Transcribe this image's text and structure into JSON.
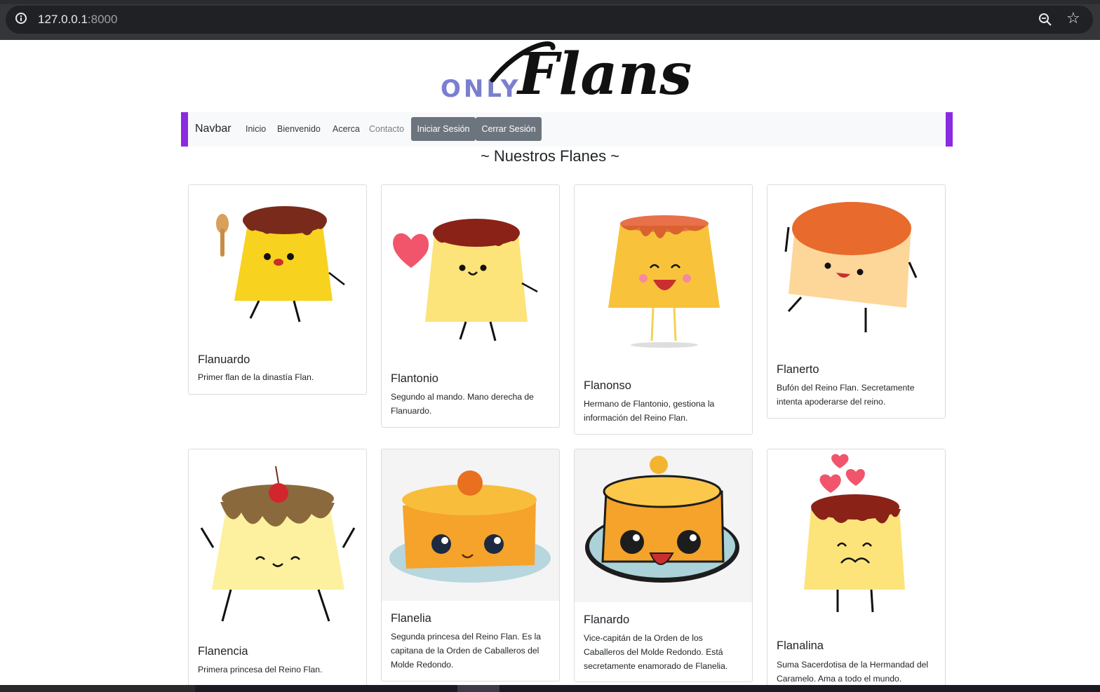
{
  "browser": {
    "url_host": "127.0.0.1",
    "url_port": ":8000"
  },
  "logo": {
    "only": "ONLY",
    "flans": "Flans"
  },
  "navbar": {
    "brand": "Navbar",
    "links": [
      "Inicio",
      "Bienvenido",
      "Acerca",
      "Contacto"
    ],
    "login": "Iniciar Sesión",
    "logout": "Cerrar Sesión",
    "accent": "#8a2be2"
  },
  "section_title": "~ Nuestros Flanes ~",
  "flans": [
    {
      "name": "Flanuardo",
      "desc": "Primer flan de la dinastía Flan."
    },
    {
      "name": "Flantonio",
      "desc": "Segundo al mando. Mano derecha de Flanuardo."
    },
    {
      "name": "Flanonso",
      "desc": "Hermano de Flantonio, gestiona la información del Reino Flan."
    },
    {
      "name": "Flanerto",
      "desc": "Bufón del Reino Flan. Secretamente intenta apoderarse del reino."
    },
    {
      "name": "Flanencia",
      "desc": "Primera princesa del Reino Flan."
    },
    {
      "name": "Flanelia",
      "desc": "Segunda princesa del Reino Flan. Es la capitana de la Orden de Caballeros del Molde Redondo."
    },
    {
      "name": "Flanardo",
      "desc": "Vice-capitán de la Orden de los Caballeros del Molde Redondo. Está secretamente enamorado de Flanelia."
    },
    {
      "name": "Flanalina",
      "desc": "Suma Sacerdotisa de la Hermandad del Caramelo. Ama a todo el mundo."
    }
  ]
}
